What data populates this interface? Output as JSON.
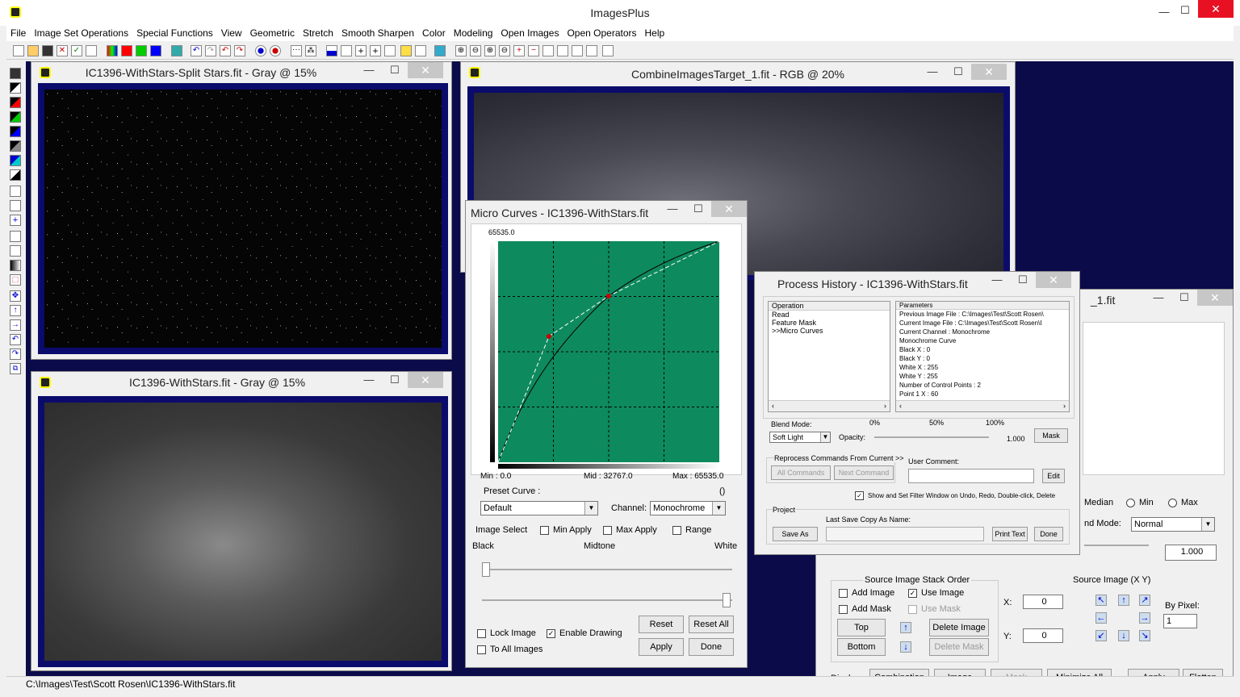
{
  "app": {
    "title": "ImagesPlus",
    "min": "—",
    "max": "☐",
    "close": "✕"
  },
  "menu": [
    "File",
    "Image Set Operations",
    "Special Functions",
    "View",
    "Geometric",
    "Stretch",
    "Smooth Sharpen",
    "Color",
    "Modeling",
    "Open Images",
    "Open Operators",
    "Help"
  ],
  "status": {
    "path": "C:\\Images\\Test\\Scott Rosen\\IC1396-WithStars.fit"
  },
  "win_split": {
    "title": "IC1396-WithStars-Split Stars.fit - Gray @ 15%"
  },
  "win_stars": {
    "title": "IC1396-WithStars.fit - Gray @ 15%"
  },
  "win_combine": {
    "title": "CombineImagesTarget_1.fit - RGB @ 20%"
  },
  "win_bg": {
    "title": "_1.fit",
    "median": "Median",
    "min": "Min",
    "max": "Max",
    "blend_label": "nd Mode:",
    "blend_value": "Normal",
    "opacity_value": "1.000",
    "stack_title": "Source Image Stack Order",
    "add_image": "Add Image",
    "use_image": "Use Image",
    "add_mask": "Add Mask",
    "use_mask": "Use Mask",
    "top": "Top",
    "bottom": "Bottom",
    "delete_image": "Delete Image",
    "delete_mask": "Delete Mask",
    "source_title": "Source Image (X Y)",
    "x_label": "X:",
    "y_label": "Y:",
    "x_value": "0",
    "y_value": "0",
    "by_pixel": "By Pixel:",
    "by_pixel_value": "1",
    "display": "Display:",
    "combination": "Combination",
    "image": "Image",
    "mask": "Mask",
    "minimize_all": "Minimize All",
    "apply": "Apply",
    "flatten": "Flatten"
  },
  "curves": {
    "title": "Micro Curves - IC1396-WithStars.fit",
    "top_value": "65535.0",
    "min": "Min :  0.0",
    "mid": "Mid :  32767.0",
    "max": "Max :  65535.0",
    "preset_label": "Preset Curve :",
    "preset_paren": "()",
    "preset_value": "Default",
    "channel_label": "Channel:",
    "channel_value": "Monochrome",
    "image_select": "Image Select",
    "min_apply": "Min Apply",
    "max_apply": "Max Apply",
    "range": "Range",
    "black": "Black",
    "midtone": "Midtone",
    "white": "White",
    "reset": "Reset",
    "reset_all": "Reset All",
    "lock_image": "Lock Image",
    "enable_drawing": "Enable Drawing",
    "to_all_images": "To All Images",
    "apply": "Apply",
    "done": "Done",
    "grid_color": "#0e8a5f"
  },
  "history": {
    "title": "Process History - IC1396-WithStars.fit",
    "op_header": "Operation",
    "ops": [
      "Read",
      "Feature Mask",
      ">>Micro Curves"
    ],
    "param_header": "Parameters",
    "params": [
      "Previous Image File : C:\\Images\\Test\\Scott Rosen\\",
      "Current Image File : C:\\Images\\Test\\Scott Rosen\\I",
      "Current Channel : Monochrome",
      "Monochrome Curve",
      "Black X : 0",
      "Black Y : 0",
      "White X : 255",
      "White Y : 255",
      "Number of Control Points : 2",
      "Point 1 X : 60"
    ],
    "blend_mode": "Blend Mode:",
    "pct0": "0%",
    "pct50": "50%",
    "pct100": "100%",
    "blend_value": "Soft Light",
    "opacity": "Opacity:",
    "opacity_value": "1.000",
    "mask": "Mask",
    "reprocess": "Reprocess Commands From Current >>",
    "all_commands": "All Commands",
    "next_command": "Next Command",
    "user_comment": "User Comment:",
    "edit": "Edit",
    "show_filter": "Show and Set Filter Window on Undo, Redo, Double-click, Delete",
    "project": "Project",
    "last_save": "Last Save Copy As Name:",
    "save_as": "Save As",
    "print_text": "Print Text",
    "done": "Done"
  }
}
